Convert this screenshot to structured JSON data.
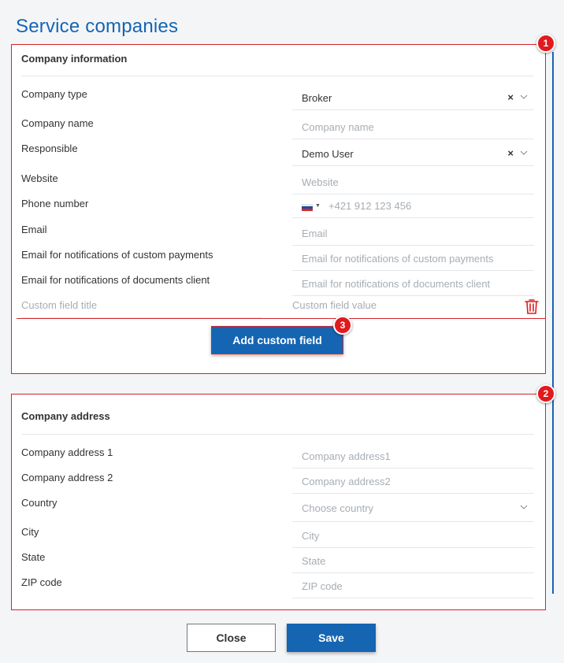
{
  "page": {
    "title": "Service companies"
  },
  "company_info": {
    "heading": "Company information",
    "company_type": {
      "label": "Company type",
      "value": "Broker",
      "clear": "×"
    },
    "company_name": {
      "label": "Company name",
      "placeholder": "Company name"
    },
    "responsible": {
      "label": "Responsible",
      "value": "Demo User",
      "clear": "×"
    },
    "website": {
      "label": "Website",
      "placeholder": "Website"
    },
    "phone": {
      "label": "Phone number",
      "placeholder": "+421 912 123 456",
      "country_flag": "slovakia-flag-icon",
      "caret": "▼"
    },
    "email": {
      "label": "Email",
      "placeholder": "Email"
    },
    "email_custom_payments": {
      "label": "Email for notifications of custom payments",
      "placeholder": "Email for notifications of custom payments"
    },
    "email_documents_client": {
      "label": "Email for notifications of documents client",
      "placeholder": "Email for notifications of documents client"
    },
    "custom_field": {
      "title_placeholder": "Custom field title",
      "value_placeholder": "Custom field value"
    },
    "add_custom_field_label": "Add custom field"
  },
  "company_address": {
    "heading": "Company address",
    "address1": {
      "label": "Company address 1",
      "placeholder": "Company address1"
    },
    "address2": {
      "label": "Company address 2",
      "placeholder": "Company address2"
    },
    "country": {
      "label": "Country",
      "placeholder": "Choose country"
    },
    "city": {
      "label": "City",
      "placeholder": "City"
    },
    "state": {
      "label": "State",
      "placeholder": "State"
    },
    "zip": {
      "label": "ZIP code",
      "placeholder": "ZIP code"
    }
  },
  "footer": {
    "close_label": "Close",
    "save_label": "Save"
  },
  "badges": [
    "1",
    "2",
    "3"
  ],
  "colors": {
    "accent": "#1565b3",
    "highlight": "#d6232a",
    "badge": "#e01a1f"
  }
}
